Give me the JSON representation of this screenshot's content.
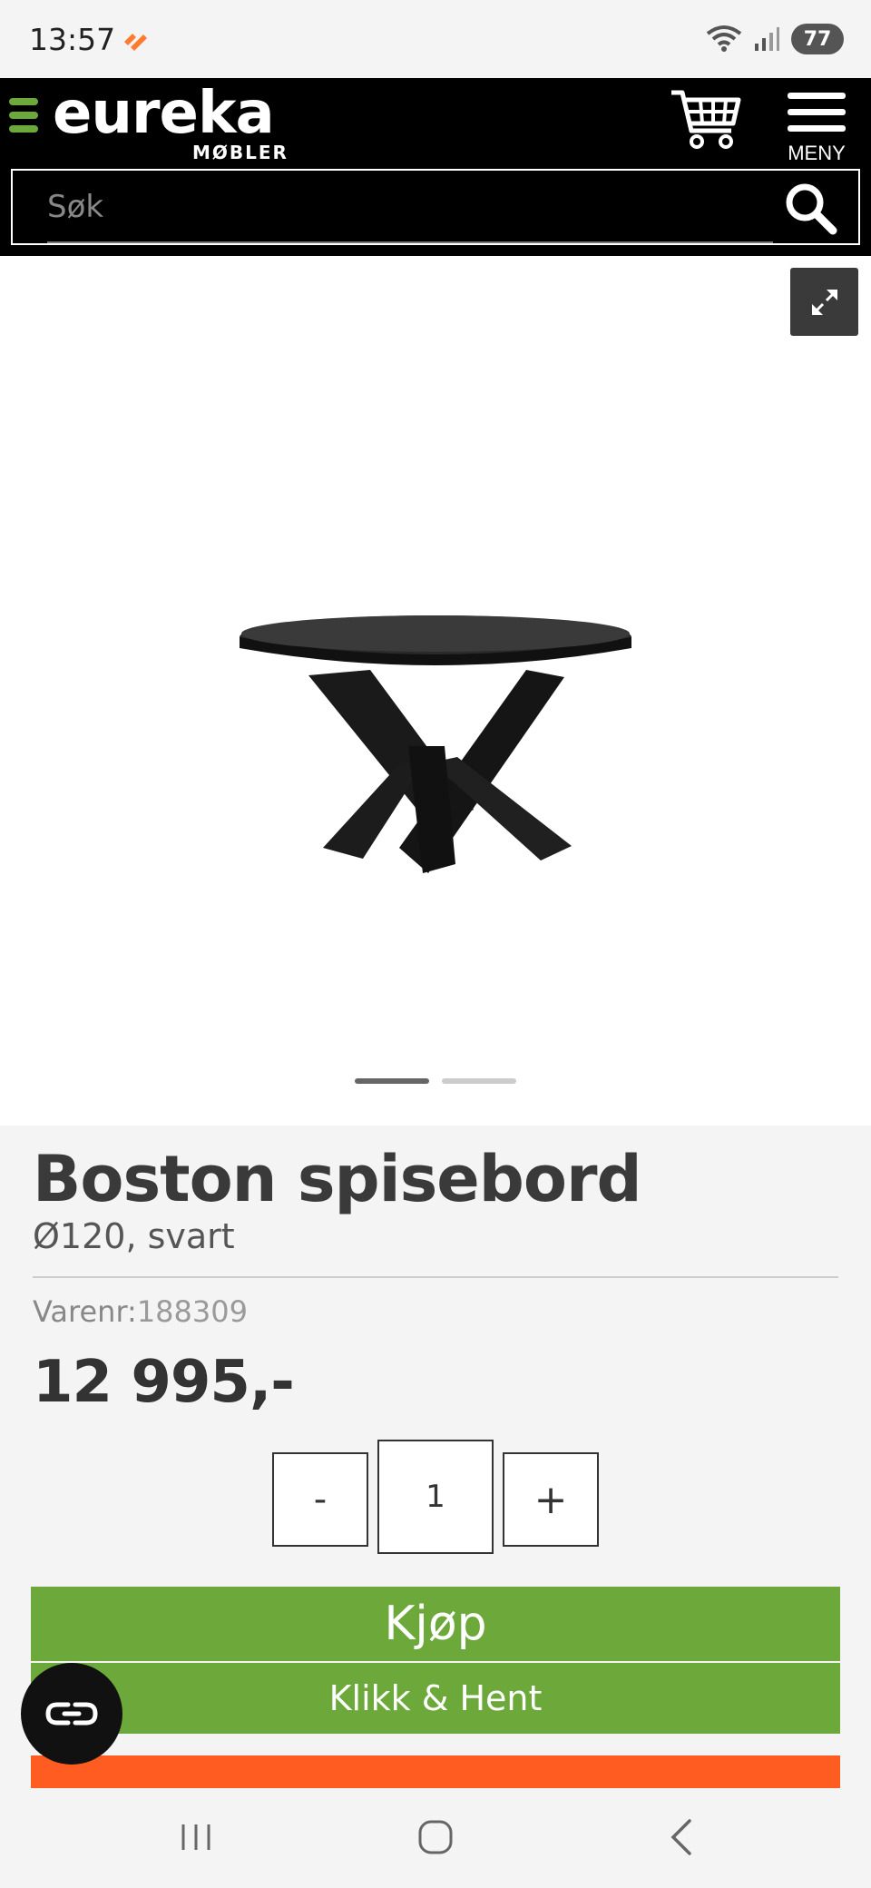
{
  "status_bar": {
    "time": "13:57",
    "battery": "77",
    "icons": [
      "wifi-icon",
      "signal-icon",
      "battery-icon"
    ]
  },
  "header": {
    "logo": "eureka",
    "logo_sub": "MØBLER",
    "menu_label": "MENY",
    "search_placeholder": "Søk",
    "icons": [
      "cart-icon",
      "menu-icon",
      "search-icon"
    ]
  },
  "gallery": {
    "image_alt": "Boston spisebord",
    "slides": 2,
    "active_slide": 1
  },
  "product": {
    "title": "Boston spisebord",
    "subtitle": "Ø120, svart",
    "sku_label": "Varenr:",
    "sku": "188309",
    "price": "12 995,-"
  },
  "quantity": {
    "minus": "-",
    "value": "1",
    "plus": "+"
  },
  "actions": {
    "buy": "Kjøp",
    "click_collect": "Klikk & Hent"
  },
  "colors": {
    "brand_green": "#6ca83a",
    "accent_orange": "#ff5c22",
    "header_bg": "#000000"
  }
}
